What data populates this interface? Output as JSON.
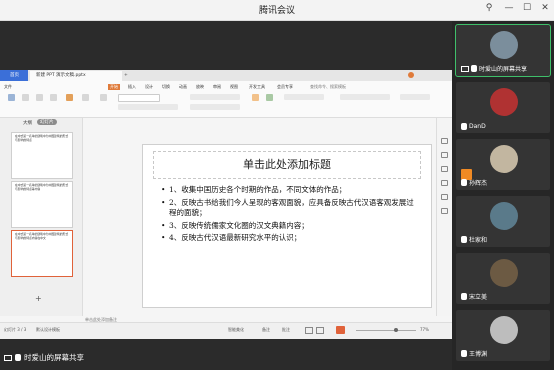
{
  "window": {
    "title": "腾讯会议"
  },
  "sidebar": {
    "participants": [
      {
        "name": "时爱山的屏幕共享",
        "color": "#7b8e9c",
        "active": true,
        "sharing": true
      },
      {
        "name": "DanD",
        "color": "#b03232"
      },
      {
        "name": "孙辉杰",
        "color": "#c2b6a0",
        "badge": true
      },
      {
        "name": "杜家和",
        "color": "#5a7a8a"
      },
      {
        "name": "宋立美",
        "color": "#6c5a43"
      },
      {
        "name": "王博渊",
        "color": "#bdbdbd"
      }
    ]
  },
  "shared": {
    "tabs": {
      "home": "首页",
      "doc": "新建 PPT 演示文稿.pptx",
      "add": "+"
    },
    "menu": [
      "文件",
      "开始",
      "插入",
      "设计",
      "切换",
      "动画",
      "放映",
      "审阅",
      "视图",
      "开发工具",
      "会员专享"
    ],
    "search": "查找命令、搜索模板",
    "panel_tabs": [
      "大纲",
      "幻灯片"
    ],
    "thumbs": [
      "在中式第一名单的建筑中为中国建筑的形式与影响的特点",
      "在中式第一名单的建筑中为中国建筑的形式与影响的特点等内容",
      "在中式第一名单的建筑中为中国建筑的形式与影响的特点内容在中文"
    ],
    "slide": {
      "title": "单击此处添加标题",
      "bullets": [
        "1、收集中国历史各个时期的作品，不同文体的作品；",
        "2、反映古书给我们今人呈现的客观面貌，应具备反映古代汉语客观发展过程的面貌；",
        "3、反映传统儒家文化圈的汉文典籍内容；",
        "4、反映古代汉语最新研究水平的认识；"
      ]
    },
    "notes": "单击此处添加备注",
    "status": {
      "page": "幻灯片 3 / 3",
      "theme": "默认设计模板",
      "smart": "智能美化",
      "notes_btn": "备注",
      "comment": "批注",
      "zoom": "77%"
    }
  },
  "footer": {
    "share_label": "时爱山的屏幕共享"
  }
}
